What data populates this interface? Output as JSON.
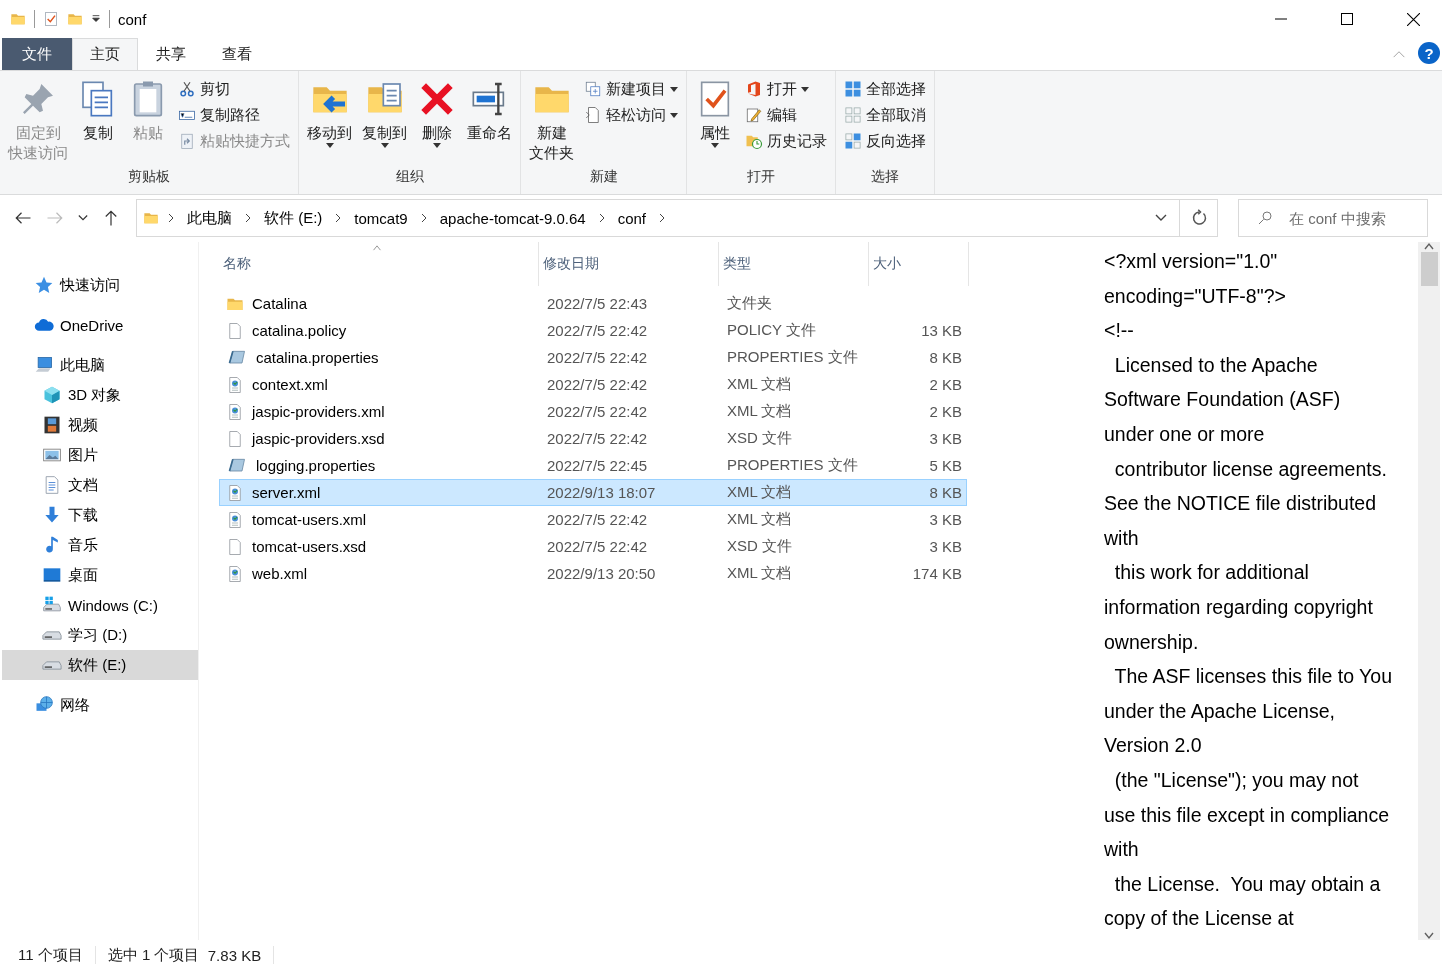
{
  "title_bar": {
    "title": "conf"
  },
  "ribbon_tabs": [
    {
      "label": "文件",
      "kind": "file",
      "selected": false
    },
    {
      "label": "主页",
      "kind": "tab",
      "selected": true
    },
    {
      "label": "共享",
      "kind": "tab",
      "selected": false
    },
    {
      "label": "查看",
      "kind": "tab",
      "selected": false
    }
  ],
  "help_label": "?",
  "ribbon_groups": [
    {
      "label": "剪贴板",
      "items": [
        {
          "kind": "large",
          "lines": [
            "固定到",
            "快速访问"
          ],
          "disabled": true,
          "dropdown": false
        },
        {
          "kind": "large",
          "lines": [
            "复制"
          ],
          "disabled": false,
          "dropdown": false
        },
        {
          "kind": "large",
          "lines": [
            "粘贴"
          ],
          "disabled": true,
          "dropdown": false
        },
        {
          "kind": "stack",
          "items": [
            {
              "label": "剪切",
              "disabled": false,
              "dropdown": false
            },
            {
              "label": "复制路径",
              "disabled": false,
              "dropdown": false
            },
            {
              "label": "粘贴快捷方式",
              "disabled": true,
              "dropdown": false
            }
          ]
        }
      ]
    },
    {
      "label": "组织",
      "items": [
        {
          "kind": "large",
          "lines": [
            "移动到"
          ],
          "disabled": false,
          "dropdown": true
        },
        {
          "kind": "large",
          "lines": [
            "复制到"
          ],
          "disabled": false,
          "dropdown": true
        },
        {
          "kind": "large",
          "lines": [
            "删除"
          ],
          "disabled": false,
          "dropdown": true
        },
        {
          "kind": "large",
          "lines": [
            "重命名"
          ],
          "disabled": false,
          "dropdown": false
        }
      ]
    },
    {
      "label": "新建",
      "items": [
        {
          "kind": "large",
          "lines": [
            "新建",
            "文件夹"
          ],
          "disabled": false,
          "dropdown": false
        },
        {
          "kind": "stack",
          "items": [
            {
              "label": "新建项目",
              "disabled": false,
              "dropdown": true
            },
            {
              "label": "轻松访问",
              "disabled": false,
              "dropdown": true
            }
          ]
        }
      ]
    },
    {
      "label": "打开",
      "items": [
        {
          "kind": "large",
          "lines": [
            "属性"
          ],
          "disabled": false,
          "dropdown": true
        },
        {
          "kind": "stack",
          "items": [
            {
              "label": "打开",
              "disabled": false,
              "dropdown": true
            },
            {
              "label": "编辑",
              "disabled": false,
              "dropdown": false
            },
            {
              "label": "历史记录",
              "disabled": false,
              "dropdown": false
            }
          ]
        }
      ]
    },
    {
      "label": "选择",
      "items": [
        {
          "kind": "stack",
          "items": [
            {
              "label": "全部选择",
              "disabled": false,
              "dropdown": false
            },
            {
              "label": "全部取消",
              "disabled": false,
              "dropdown": false
            },
            {
              "label": "反向选择",
              "disabled": false,
              "dropdown": false
            }
          ]
        }
      ]
    }
  ],
  "address_bar": {
    "breadcrumbs": [
      "此电脑",
      "软件 (E:)",
      "tomcat9",
      "apache-tomcat-9.0.64",
      "conf"
    ]
  },
  "search": {
    "placeholder": "在 conf 中搜索"
  },
  "nav_pane": [
    {
      "label": "快速访问",
      "selected": false
    },
    {
      "label": "OneDrive",
      "selected": false
    },
    {
      "label": "此电脑",
      "selected": false,
      "children": [
        {
          "label": "3D 对象",
          "selected": false
        },
        {
          "label": "视频",
          "selected": false
        },
        {
          "label": "图片",
          "selected": false
        },
        {
          "label": "文档",
          "selected": false
        },
        {
          "label": "下载",
          "selected": false
        },
        {
          "label": "音乐",
          "selected": false
        },
        {
          "label": "桌面",
          "selected": false
        },
        {
          "label": "Windows (C:)",
          "selected": false
        },
        {
          "label": "学习 (D:)",
          "selected": false
        },
        {
          "label": "软件 (E:)",
          "selected": true
        }
      ]
    },
    {
      "label": "网络",
      "selected": false
    }
  ],
  "file_list": {
    "columns": [
      {
        "label": "名称",
        "sorted": true
      },
      {
        "label": "修改日期",
        "sorted": false
      },
      {
        "label": "类型",
        "sorted": false
      },
      {
        "label": "大小",
        "sorted": false
      }
    ],
    "rows": [
      {
        "name": "Catalina",
        "date": "2022/7/5 22:43",
        "type": "文件夹",
        "size": "",
        "kind": "folder",
        "selected": false
      },
      {
        "name": "catalina.policy",
        "date": "2022/7/5 22:42",
        "type": "POLICY 文件",
        "size": "13 KB",
        "kind": "file",
        "selected": false
      },
      {
        "name": "catalina.properties",
        "date": "2022/7/5 22:42",
        "type": "PROPERTIES 文件",
        "size": "8 KB",
        "kind": "properties",
        "selected": false
      },
      {
        "name": "context.xml",
        "date": "2022/7/5 22:42",
        "type": "XML 文档",
        "size": "2 KB",
        "kind": "xml",
        "selected": false
      },
      {
        "name": "jaspic-providers.xml",
        "date": "2022/7/5 22:42",
        "type": "XML 文档",
        "size": "2 KB",
        "kind": "xml",
        "selected": false
      },
      {
        "name": "jaspic-providers.xsd",
        "date": "2022/7/5 22:42",
        "type": "XSD 文件",
        "size": "3 KB",
        "kind": "file",
        "selected": false
      },
      {
        "name": "logging.properties",
        "date": "2022/7/5 22:45",
        "type": "PROPERTIES 文件",
        "size": "5 KB",
        "kind": "properties",
        "selected": false
      },
      {
        "name": "server.xml",
        "date": "2022/9/13 18:07",
        "type": "XML 文档",
        "size": "8 KB",
        "kind": "xml",
        "selected": true
      },
      {
        "name": "tomcat-users.xml",
        "date": "2022/7/5 22:42",
        "type": "XML 文档",
        "size": "3 KB",
        "kind": "xml",
        "selected": false
      },
      {
        "name": "tomcat-users.xsd",
        "date": "2022/7/5 22:42",
        "type": "XSD 文件",
        "size": "3 KB",
        "kind": "file",
        "selected": false
      },
      {
        "name": "web.xml",
        "date": "2022/9/13 20:50",
        "type": "XML 文档",
        "size": "174 KB",
        "kind": "xml",
        "selected": false
      }
    ]
  },
  "preview": {
    "lines": [
      "<?xml version=\"1.0\"",
      "encoding=\"UTF-8\"?>",
      "<!--",
      "  Licensed to the Apache",
      "Software Foundation (ASF)",
      "under one or more",
      "  contributor license agreements.",
      "See the NOTICE file distributed",
      "with",
      "  this work for additional",
      "information regarding copyright",
      "ownership.",
      "  The ASF licenses this file to You",
      "under the Apache License,",
      "Version 2.0",
      "  (the \"License\"); you may not",
      "use this file except in compliance",
      "with",
      "  the License.  You may obtain a",
      "copy of the License at"
    ]
  },
  "status_bar": {
    "count": "11 个项目",
    "selection": "选中 1 个项目",
    "size": "7.83 KB"
  }
}
